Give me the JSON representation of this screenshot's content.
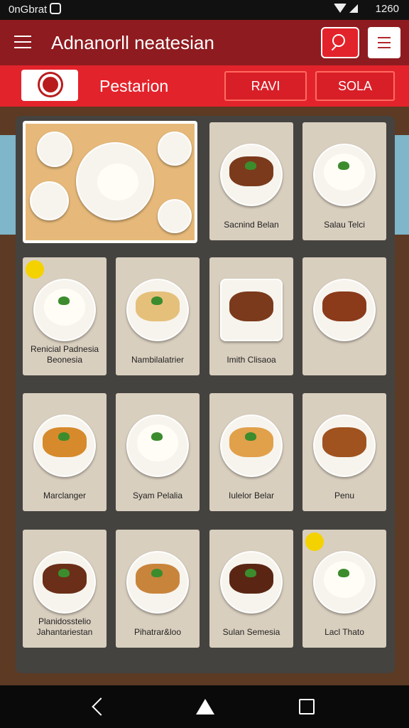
{
  "status": {
    "left_text": "0nGbrat",
    "right_text": "1260"
  },
  "app": {
    "title": "Adnanorll neatesian"
  },
  "tabbar": {
    "title": "Pestarion",
    "tab1": "RAVI",
    "tab2": "SOLA"
  },
  "colors": {
    "appbar": "#8e1b1f",
    "tabbar": "#e3232b",
    "panel": "#454340",
    "card": "#d9cfbf"
  },
  "cards": [
    {
      "label": "",
      "type": "feature"
    },
    {
      "label": "Sacnind Belan"
    },
    {
      "label": "Salau Telci"
    },
    {
      "label": "Renicial Padnesia Beonesia"
    },
    {
      "label": "Nambilalatrier"
    },
    {
      "label": "Imith Clisaoa"
    },
    {
      "label": ""
    },
    {
      "label": "Marclanger"
    },
    {
      "label": "Syam Pelalia"
    },
    {
      "label": "Iulelor Belar"
    },
    {
      "label": "Penu"
    },
    {
      "label": "Planidosstelio Jahantariestan"
    },
    {
      "label": "Pihatrar&loo"
    },
    {
      "label": "Sulan Semesia"
    },
    {
      "label": "Lacl Thato"
    }
  ]
}
